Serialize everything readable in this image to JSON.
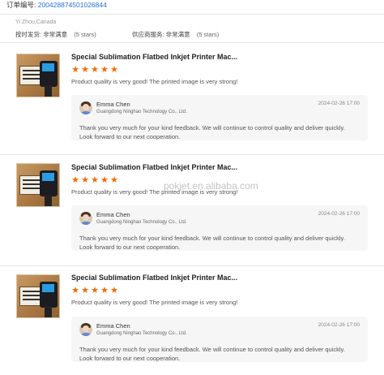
{
  "order": {
    "label": "订单编号:",
    "number": "200428874501026844"
  },
  "buyer": {
    "location": "Yi Zhou,Canada"
  },
  "ratings": {
    "shipping_label": "按时发货:",
    "shipping_value": "非常满意",
    "shipping_stars": "(5 stars)",
    "supplier_label": "供应商服务:",
    "supplier_value": "非常满意",
    "supplier_stars": "(5 stars)"
  },
  "star_glyph": "★",
  "star_color": "#f56a00",
  "watermark": "pokjet.en.alibaba.com",
  "reviews": [
    {
      "product_title": "Special Sublimation Flatbed Inkjet Printer Mac...",
      "rating": 5,
      "comment": "Product quality is very good! The printed image is very strong!",
      "reply": {
        "name": "Emma Chen",
        "company": "Guangdong Ninghao Technology Co., Ltd.",
        "date": "2024-02-26 17:00",
        "message": "Thank you very much for your kind feedback. We will continue to control quality and deliver quickly. Look forward to our next cooperation."
      }
    },
    {
      "product_title": "Special Sublimation Flatbed Inkjet Printer Mac...",
      "rating": 5,
      "comment": "Product quality is very good! The printed image is very strong!",
      "reply": {
        "name": "Emma Chen",
        "company": "Guangdong Ninghao Technology Co., Ltd.",
        "date": "2024-02-26 17:00",
        "message": "Thank you very much for your kind feedback. We will continue to control quality and deliver quickly. Look forward to our next cooperation."
      }
    },
    {
      "product_title": "Special Sublimation Flatbed Inkjet Printer Mac...",
      "rating": 5,
      "comment": "Product quality is very good! The printed image is very strong!",
      "reply": {
        "name": "Emma Chen",
        "company": "Guangdong Ninghao Technology Co., Ltd.",
        "date": "2024-02-26 17:00",
        "message": "Thank you very much for your kind feedback. We will continue to control quality and deliver quickly. Look forward to our next cooperation."
      }
    }
  ]
}
